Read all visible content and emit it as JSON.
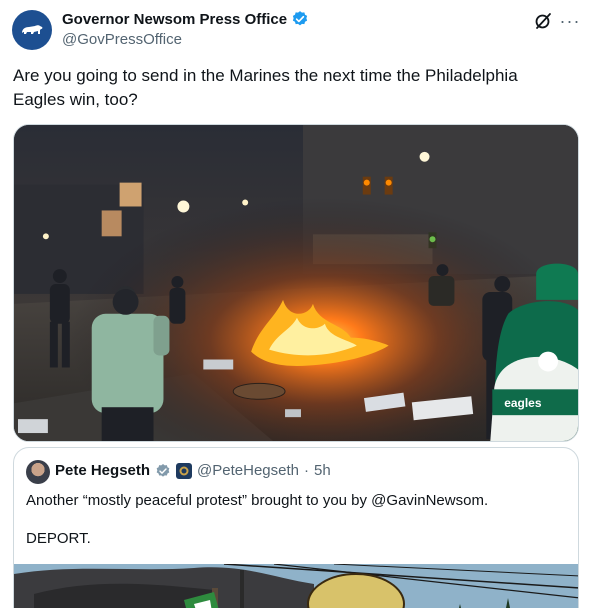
{
  "author": {
    "display_name": "Governor Newsom Press Office",
    "handle": "@GovPressOffice"
  },
  "tweet": {
    "text": "Are you going to send in the Marines the next time the Philadelphia Eagles win, too?"
  },
  "quote": {
    "display_name": "Pete Hegseth",
    "handle": "@PeteHegseth",
    "separator": "·",
    "time": "5h",
    "text": "Another “mostly peaceful protest” brought to you by @GavinNewsom.",
    "text2": "DEPORT."
  },
  "icons": {
    "avatar": "california-bear-icon",
    "verified": "verified-badge-icon",
    "grok": "grok-icon",
    "more": "more-icon"
  },
  "colors": {
    "verified_blue": "#1d9bf0",
    "secondary_text": "#536471",
    "border": "#cfd9de",
    "gov_badge": "#1e3a5f"
  }
}
